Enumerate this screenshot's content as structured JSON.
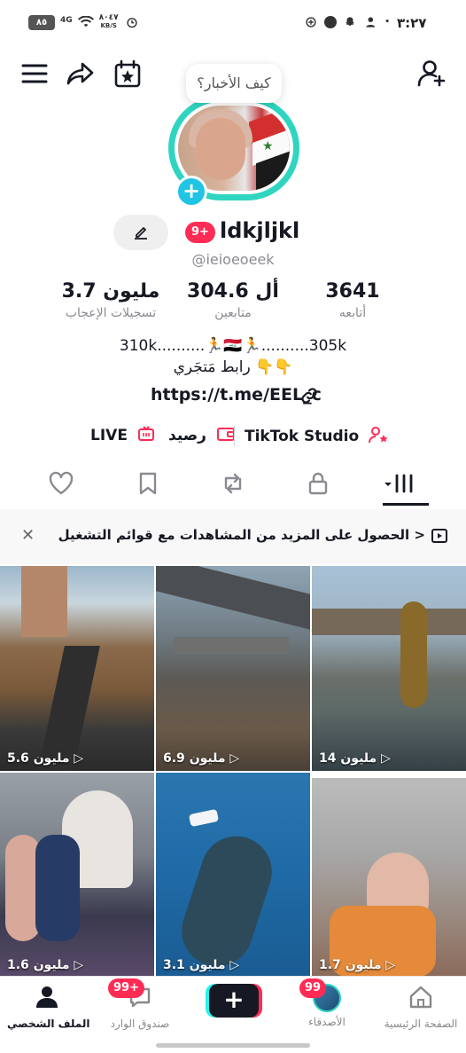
{
  "status_bar": {
    "time": "٣:٢٧",
    "battery": "٨٥",
    "network": "4G",
    "speed_value": "٨٠٤٧",
    "speed_unit": "KB/S"
  },
  "profile": {
    "bubble_text": "كيف الأخبار؟",
    "notification_badge": "9+",
    "username": "ldkjljkl",
    "handle": "@ieioeoeek",
    "stats": {
      "following_value": "3641",
      "following_label": "أتابعه",
      "followers_value": "304.6 أل",
      "followers_label": "متابعين",
      "likes_value": "3.7 مليون",
      "likes_label": "تسجيلات الإعجاب"
    },
    "bio_line1": "310k..........🏃🇮🇶🏃..........305k",
    "bio_line2": "رابط مَتجَري 👇👇",
    "bio_link": "https://t.me/EEL_c"
  },
  "quick_links": {
    "studio": "TikTok Studio",
    "balance": "رصيد",
    "live": "LIVE"
  },
  "playlist_banner": {
    "text": "الحصول على المزيد من المشاهدات مع قوائم التشغيل >"
  },
  "videos": [
    {
      "views": "5.6 مليون"
    },
    {
      "views": "6.9 مليون"
    },
    {
      "views": "14 مليون"
    },
    {
      "views": "1.6 مليون"
    },
    {
      "views": "3.1 مليون"
    },
    {
      "views": "1.7 مليون"
    }
  ],
  "bottom_nav": {
    "home": "الصفحة الرئيسية",
    "friends": "الأصدقاء",
    "friends_badge": "99",
    "inbox": "صندوق الوارد",
    "inbox_badge": "99+",
    "profile": "الملف الشخصي"
  },
  "colors": {
    "accent": "#fe2c55",
    "ring": "#2fd5c0",
    "cyan": "#25f4ee"
  }
}
